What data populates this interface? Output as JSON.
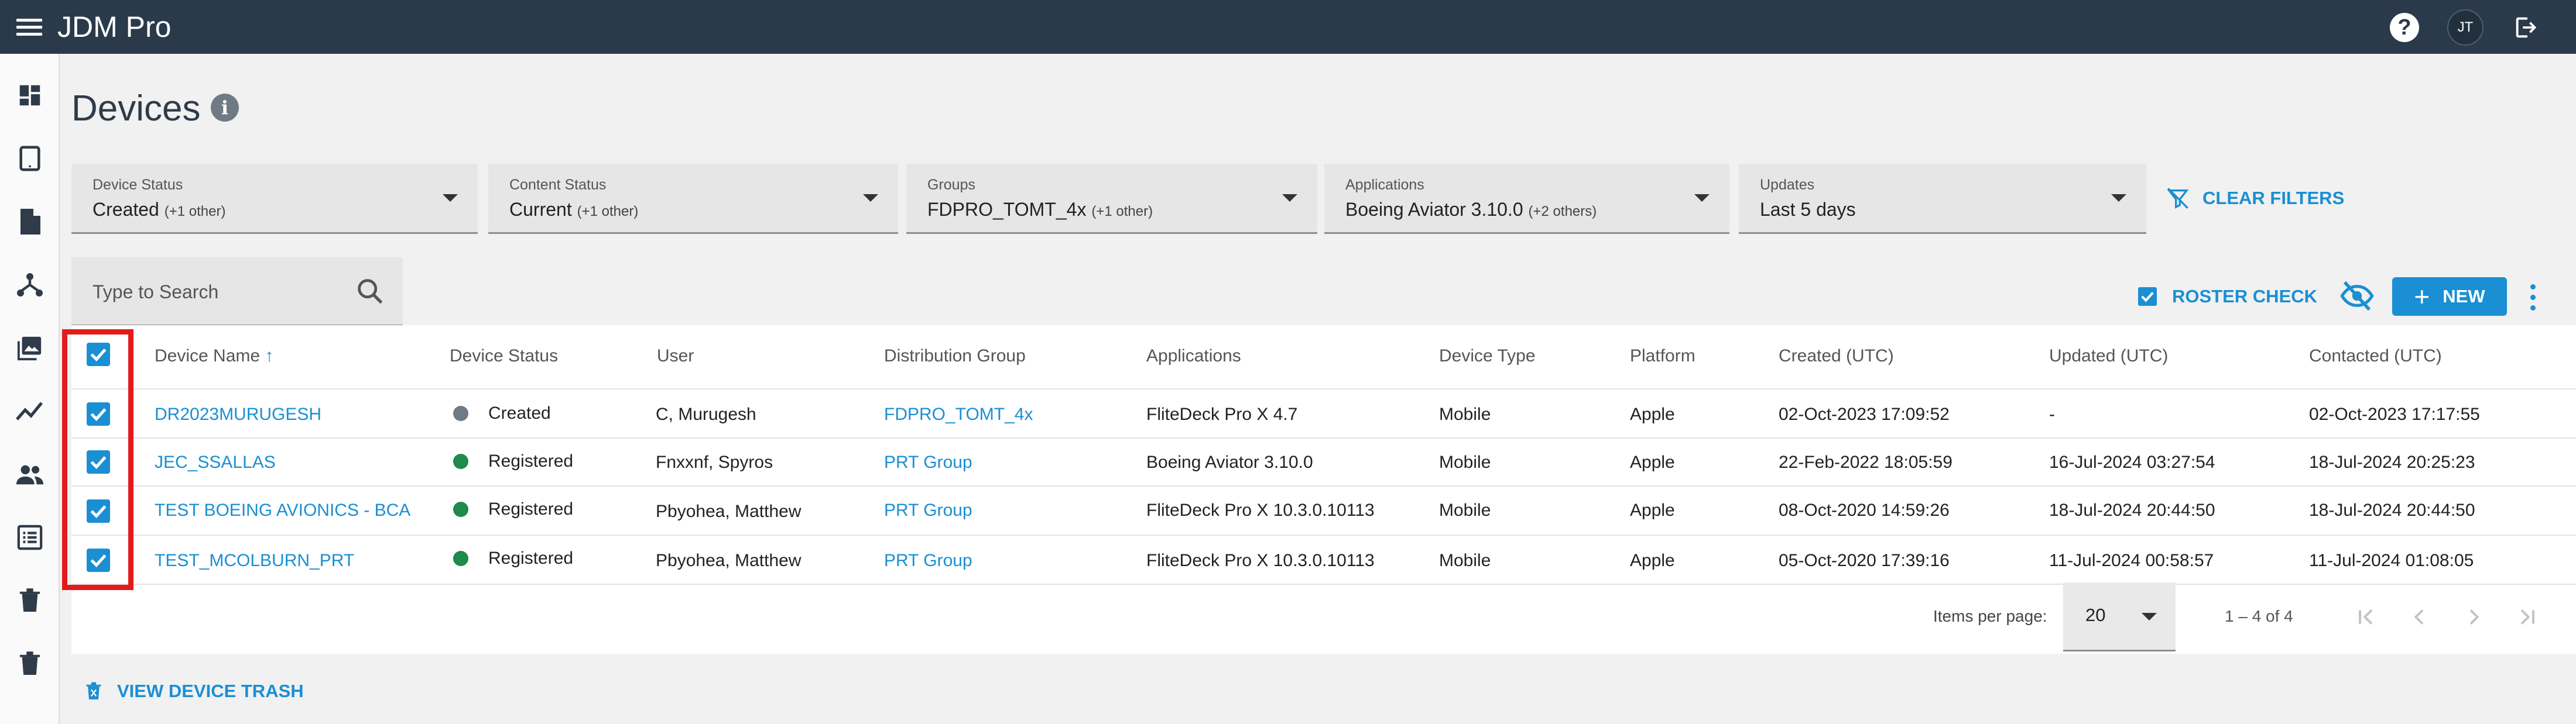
{
  "app": {
    "title": "JDM Pro",
    "user_initials": "JT",
    "help_glyph": "?"
  },
  "page": {
    "title": "Devices",
    "info_glyph": "i"
  },
  "filters": [
    {
      "label": "Device Status",
      "value": "Created",
      "extra": "(+1 other)"
    },
    {
      "label": "Content Status",
      "value": "Current",
      "extra": "(+1 other)"
    },
    {
      "label": "Groups",
      "value": "FDPRO_TOMT_4x",
      "extra": "(+1 other)"
    },
    {
      "label": "Applications",
      "value": "Boeing Aviator 3.10.0",
      "extra": "(+2 others)"
    },
    {
      "label": "Updates",
      "value": "Last 5 days",
      "extra": ""
    }
  ],
  "clear_filters_label": "CLEAR FILTERS",
  "search": {
    "placeholder": "Type to Search"
  },
  "toolbar": {
    "roster_label": "ROSTER CHECK",
    "new_label": "NEW",
    "new_glyph": "+"
  },
  "table": {
    "headers": [
      "Device Name",
      "Device Status",
      "User",
      "Distribution Group",
      "Applications",
      "Device Type",
      "Platform",
      "Created (UTC)",
      "Updated (UTC)",
      "Contacted (UTC)"
    ],
    "sort_arrow": "↑",
    "rows": [
      {
        "name": "DR2023MURUGESH",
        "status": "Created",
        "user": "C, Murugesh",
        "group": "FDPRO_TOMT_4x",
        "app": "FliteDeck Pro X 4.7",
        "type": "Mobile",
        "platform": "Apple",
        "created": "02-Oct-2023 17:09:52",
        "updated": "-",
        "contacted": "02-Oct-2023 17:17:55"
      },
      {
        "name": "JEC_SSALLAS",
        "status": "Registered",
        "user": "Fnxxnf, Spyros",
        "group": "PRT Group",
        "app": "Boeing Aviator 3.10.0",
        "type": "Mobile",
        "platform": "Apple",
        "created": "22-Feb-2022 18:05:59",
        "updated": "16-Jul-2024 03:27:54",
        "contacted": "18-Jul-2024 20:25:23"
      },
      {
        "name": "TEST BOEING AVIONICS - BCA",
        "status": "Registered",
        "user": "Pbyohea, Matthew",
        "group": "PRT Group",
        "app": "FliteDeck Pro X 10.3.0.10113",
        "type": "Mobile",
        "platform": "Apple",
        "created": "08-Oct-2020 14:59:26",
        "updated": "18-Jul-2024 20:44:50",
        "contacted": "18-Jul-2024 20:44:50"
      },
      {
        "name": "TEST_MCOLBURN_PRT",
        "status": "Registered",
        "user": "Pbyohea, Matthew",
        "group": "PRT Group",
        "app": "FliteDeck Pro X 10.3.0.10113",
        "type": "Mobile",
        "platform": "Apple",
        "created": "05-Oct-2020 17:39:16",
        "updated": "11-Jul-2024 00:58:57",
        "contacted": "11-Jul-2024 01:08:05"
      }
    ]
  },
  "paginator": {
    "items_per_page_label": "Items per page:",
    "items_per_page": "20",
    "range": "1 – 4 of 4"
  },
  "trash_link": "VIEW DEVICE TRASH",
  "colors": {
    "topbar": "#2a3a4a",
    "accent": "#1a8fd3",
    "status_created": "#6f7a84",
    "status_registered": "#1e8a4c",
    "highlight": "#e31b1b"
  }
}
